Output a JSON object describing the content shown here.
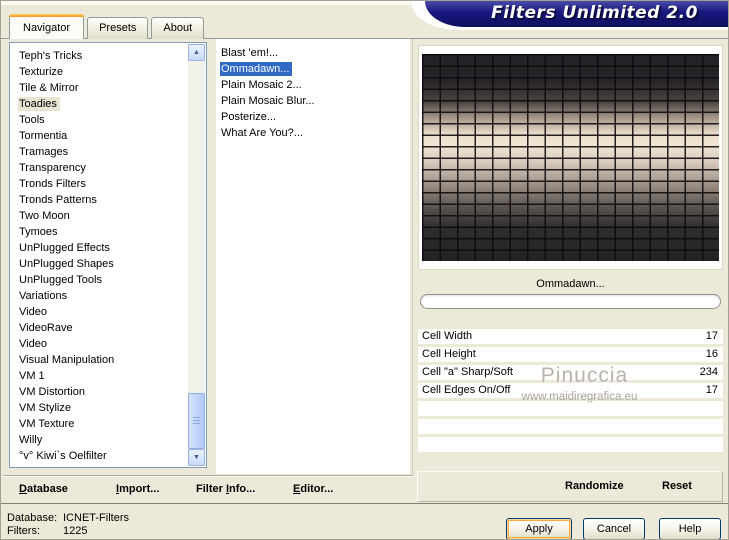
{
  "window": {
    "title": "Filters Unlimited 2.0"
  },
  "tabs": [
    {
      "label": "Navigator",
      "active": true
    },
    {
      "label": "Presets",
      "active": false
    },
    {
      "label": "About",
      "active": false
    }
  ],
  "category_list": {
    "selected_index": 3,
    "items": [
      "Teph's Tricks",
      "Texturize",
      "Tile & Mirror",
      "Toadies",
      "Tools",
      "Tormentia",
      "Tramages",
      "Transparency",
      "Tronds Filters",
      "Tronds Patterns",
      "Two Moon",
      "Tymoes",
      "UnPlugged Effects",
      "UnPlugged Shapes",
      "UnPlugged Tools",
      "Variations",
      "Video",
      "VideoRave",
      "Video",
      "Visual Manipulation",
      "VM 1",
      "VM Distortion",
      "VM Stylize",
      "VM Texture",
      "Willy",
      "°v° Kiwi`s Oelfilter"
    ]
  },
  "filter_list": {
    "selected_index": 1,
    "items": [
      "Blast 'em!...",
      "Ommadawn...",
      "Plain Mosaic 2...",
      "Plain Mosaic Blur...",
      "Posterize...",
      "What Are You?..."
    ]
  },
  "preview": {
    "caption": "Ommadawn...",
    "progress_percent": 0
  },
  "parameters": [
    {
      "name": "Cell Width",
      "value": "17"
    },
    {
      "name": "Cell Height",
      "value": "16"
    },
    {
      "name": "Cell \"a\" Sharp/Soft",
      "value": "234"
    },
    {
      "name": "Cell Edges On/Off",
      "value": "17"
    }
  ],
  "parameters_empty_rows": 3,
  "watermark": {
    "line1": "Pinuccia",
    "line2": "www.maidiregrafica.eu"
  },
  "toolbar": {
    "buttons": [
      {
        "name": "database",
        "pre": "",
        "key": "D",
        "post": "atabase"
      },
      {
        "name": "import",
        "pre": "",
        "key": "I",
        "post": "mport..."
      },
      {
        "name": "filter-info",
        "pre": "Filter ",
        "key": "I",
        "post": "nfo..."
      },
      {
        "name": "editor",
        "pre": "",
        "key": "E",
        "post": "ditor..."
      }
    ]
  },
  "actions": {
    "randomize": "Randomize",
    "reset": "Reset"
  },
  "status": {
    "database_label": "Database:",
    "database_value": "ICNET-Filters",
    "filters_label": "Filters:",
    "filters_value": "1225"
  },
  "buttons": {
    "apply": "Apply",
    "cancel": "Cancel",
    "help": "Help"
  },
  "icons": {
    "scroll_up": "▲",
    "scroll_down": "▼"
  },
  "colors": {
    "bg": "#ece9d8",
    "banner": "#17177e",
    "selection": "#316ac5",
    "category_highlight": "#e9e5d3",
    "listbox_border": "#7f9db9",
    "button_border": "#003c74",
    "apply_focus": "#f9a940",
    "watermark": "#b8b4aa"
  }
}
